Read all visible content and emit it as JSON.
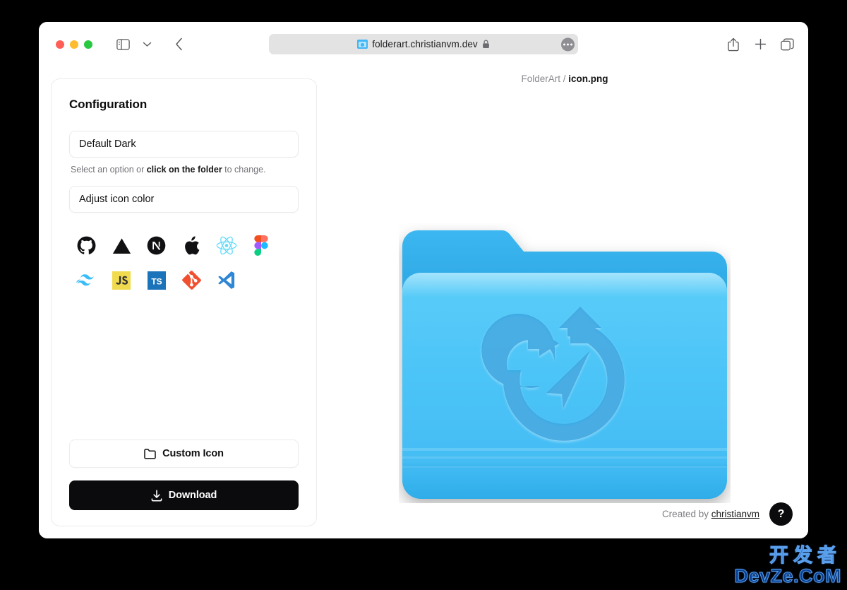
{
  "browser": {
    "traffic_lights": [
      "close",
      "minimize",
      "maximize"
    ],
    "sidebar_toggle": "sidebar-toggle-icon",
    "tab_chevron": "chevron-down-icon",
    "back": "back-arrow-icon",
    "url": "folderart.christianvm.dev",
    "favicon": "folder-favicon",
    "lock": "lock-icon",
    "page_menu": "ellipsis-icon",
    "share": "share-icon",
    "new_tab": "plus-icon",
    "tab_overview": "tab-overview-icon"
  },
  "config": {
    "title": "Configuration",
    "theme_select": {
      "value": "Default Dark",
      "placeholder": "Default Dark"
    },
    "hint": {
      "before": "Select an option or ",
      "bold": "click on the folder",
      "after": " to change."
    },
    "color_select": {
      "value": "Adjust icon color",
      "placeholder": "Adjust icon color"
    },
    "icons": [
      {
        "name": "github-icon",
        "label": "GitHub"
      },
      {
        "name": "vercel-icon",
        "label": "Vercel"
      },
      {
        "name": "nextjs-icon",
        "label": "Next.js"
      },
      {
        "name": "apple-icon",
        "label": "Apple"
      },
      {
        "name": "react-icon",
        "label": "React"
      },
      {
        "name": "figma-icon",
        "label": "Figma"
      },
      {
        "name": "tailwind-icon",
        "label": "Tailwind CSS"
      },
      {
        "name": "javascript-icon",
        "label": "JavaScript"
      },
      {
        "name": "typescript-icon",
        "label": "TypeScript"
      },
      {
        "name": "git-icon",
        "label": "Git"
      },
      {
        "name": "vscode-icon",
        "label": "VS Code"
      }
    ],
    "custom_icon_button": "Custom Icon",
    "download_button": "Download"
  },
  "preview": {
    "breadcrumb_root": "FolderArt",
    "breadcrumb_separator": "/",
    "breadcrumb_file": "icon.png",
    "folder_icon_name": "navigation-refresh-icon",
    "colors": {
      "folder_front_top": "#55c8f8",
      "folder_front_bottom": "#3ab4ef",
      "folder_back_top": "#3bb4ee",
      "folder_back_bottom": "#1186c9",
      "emboss": "#3aa5de",
      "accent": "#3fb6f5"
    }
  },
  "footer": {
    "credit_prefix": "Created by ",
    "credit_link": "christianvm",
    "help_label": "?"
  },
  "watermark": {
    "line1": "开发者",
    "line2": "DevZe.CoM"
  }
}
